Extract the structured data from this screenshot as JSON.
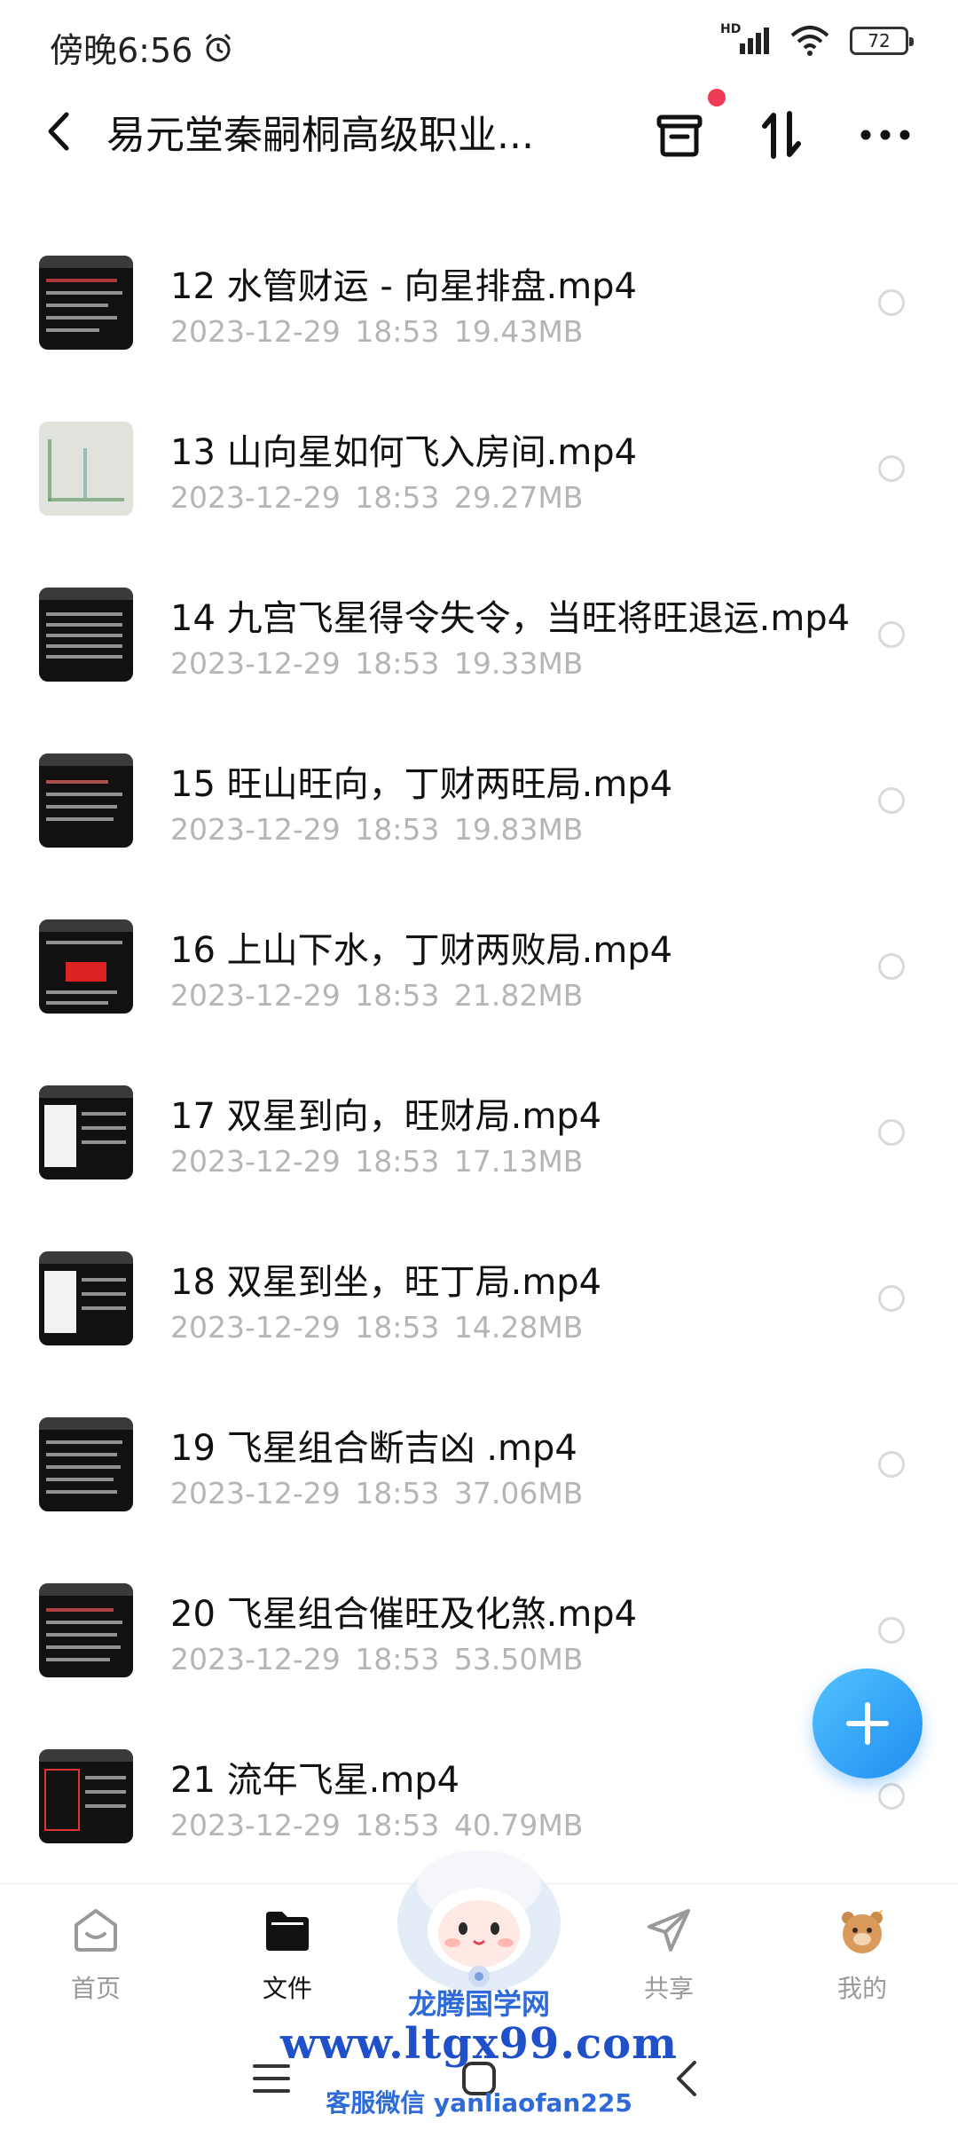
{
  "status_bar": {
    "time": "傍晚6:56",
    "network": "HD",
    "battery": "72"
  },
  "header": {
    "title": "易元堂秦嗣桐高级职业..."
  },
  "files": [
    {
      "name": "12 水管财运 - 向星排盘.mp4",
      "meta": "2023-12-29   18:53   19.43MB",
      "thumb": "dark"
    },
    {
      "name": "13 山向星如何飞入房间.mp4",
      "meta": "2023-12-29   18:53   29.27MB",
      "thumb": "light"
    },
    {
      "name": "14 九宫飞星得令失令，当旺将旺退运.mp4",
      "meta": "2023-12-29   18:53   19.33MB",
      "thumb": "dark"
    },
    {
      "name": "15 旺山旺向，丁财两旺局.mp4",
      "meta": "2023-12-29   18:53   19.83MB",
      "thumb": "dark"
    },
    {
      "name": "16 上山下水，丁财两败局.mp4",
      "meta": "2023-12-29   18:53   21.82MB",
      "thumb": "dark-red"
    },
    {
      "name": "17 双星到向，旺财局.mp4",
      "meta": "2023-12-29   18:53   17.13MB",
      "thumb": "dark"
    },
    {
      "name": "18 双星到坐，旺丁局.mp4",
      "meta": "2023-12-29   18:53   14.28MB",
      "thumb": "dark"
    },
    {
      "name": "19 飞星组合断吉凶 .mp4",
      "meta": "2023-12-29   18:53   37.06MB",
      "thumb": "dark"
    },
    {
      "name": "20 飞星组合催旺及化煞.mp4",
      "meta": "2023-12-29   18:53   53.50MB",
      "thumb": "dark"
    },
    {
      "name": "21 流年飞星.mp4",
      "meta": "2023-12-29   18:53   40.79MB",
      "thumb": "dark"
    }
  ],
  "tabs": [
    {
      "label": "首页",
      "icon": "home-icon"
    },
    {
      "label": "文件",
      "icon": "folder-icon",
      "active": true
    },
    {
      "label": "共享",
      "icon": "share-icon"
    },
    {
      "label": "我的",
      "icon": "profile-icon"
    }
  ],
  "watermark": {
    "title": "龙腾国学网",
    "url": "www.ltgx99.com",
    "contact": "客服微信 yanliaofan225"
  },
  "colors": {
    "accent": "#1f8df0",
    "notification": "#ee3a55",
    "meta_text": "#b5b5b5"
  }
}
